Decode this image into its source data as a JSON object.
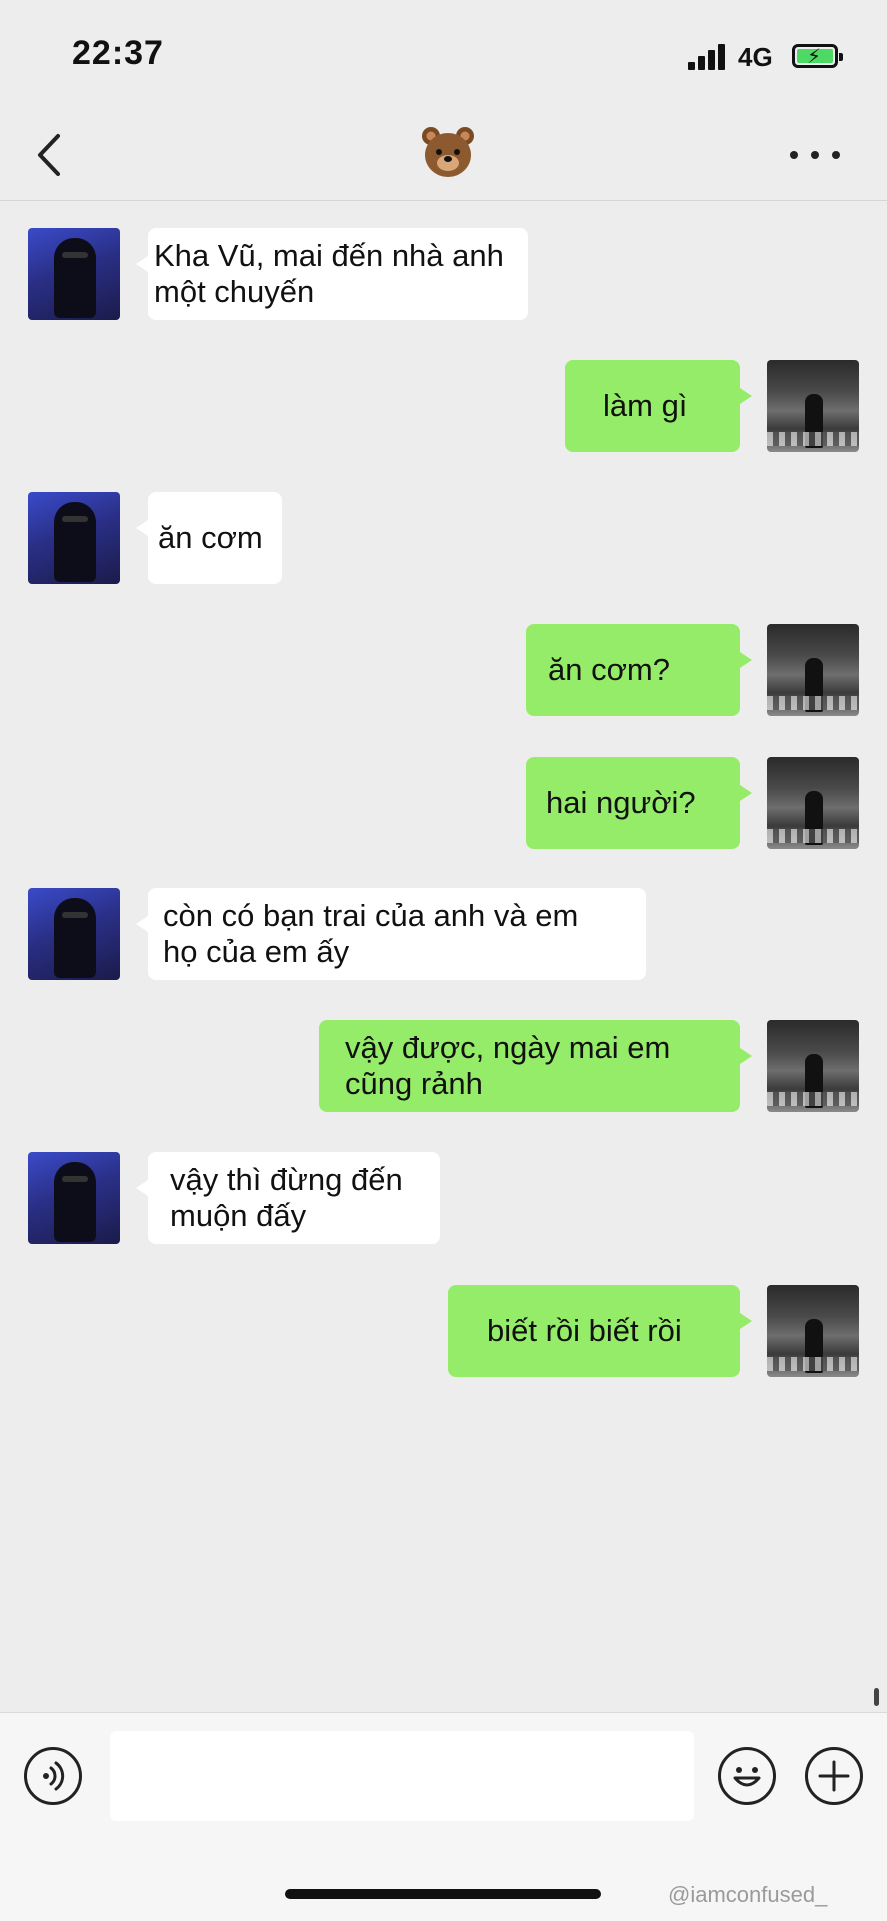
{
  "status_bar": {
    "time": "22:37",
    "network": "4G"
  },
  "nav": {
    "title_icon": "bear-face-emoji",
    "title_glyph": "🐻"
  },
  "messages": [
    {
      "side": "in",
      "text": "Kha Vũ, mai đến nhà anh\nmột chuyến"
    },
    {
      "side": "out",
      "text": "làm gì"
    },
    {
      "side": "in",
      "text": "ăn cơm"
    },
    {
      "side": "out",
      "text": "ăn cơm?"
    },
    {
      "side": "out",
      "text": "hai người?"
    },
    {
      "side": "in",
      "text": "còn có bạn trai của anh và em\nhọ của em ấy"
    },
    {
      "side": "out",
      "text": "vậy được, ngày mai em\ncũng rảnh"
    },
    {
      "side": "in",
      "text": "vậy thì đừng đến\nmuộn đấy"
    },
    {
      "side": "out",
      "text": "biết rồi biết rồi"
    }
  ],
  "input_bar": {
    "placeholder": ""
  },
  "watermark": "@iamconfused_"
}
